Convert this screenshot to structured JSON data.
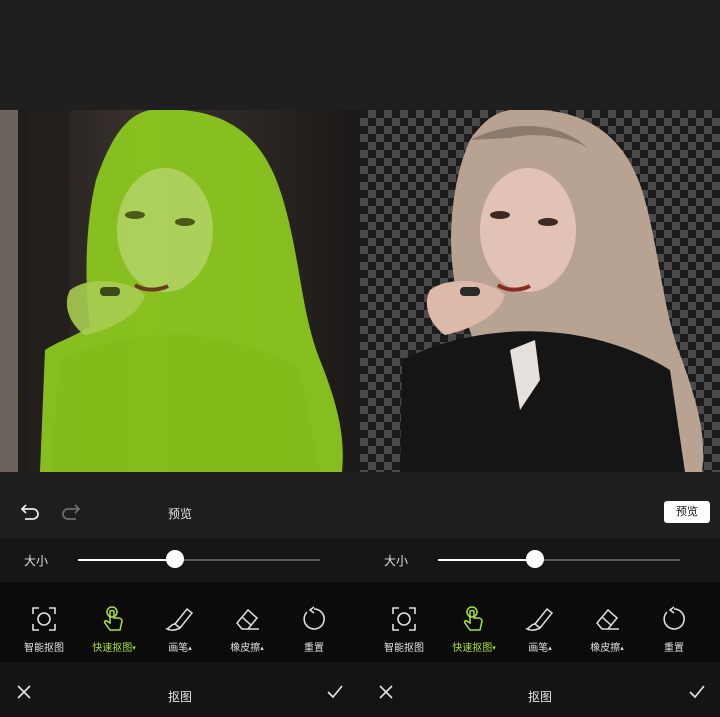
{
  "panes": [
    {
      "mode": "editing",
      "edit_bar": {
        "undo_icon": "undo-icon",
        "redo_icon": "redo-icon",
        "title": "预览",
        "preview_button": ""
      },
      "slider": {
        "label": "大小",
        "value": 0.4
      },
      "tools": [
        {
          "label": "智能抠图",
          "icon": "smart-cutout-icon",
          "active": false,
          "caret": ""
        },
        {
          "label": "快速抠图",
          "icon": "quick-cutout-icon",
          "active": true,
          "caret": "▾"
        },
        {
          "label": "画笔",
          "icon": "brush-icon",
          "active": false,
          "caret": "▴"
        },
        {
          "label": "橡皮擦",
          "icon": "eraser-icon",
          "active": false,
          "caret": "▴"
        },
        {
          "label": "重置",
          "icon": "reset-icon",
          "active": false,
          "caret": ""
        }
      ],
      "bottom_bar": {
        "title": "抠图",
        "cancel_icon": "close-icon",
        "confirm_icon": "check-icon"
      }
    },
    {
      "mode": "preview",
      "edit_bar": {
        "undo_icon": "",
        "redo_icon": "",
        "title": "",
        "preview_button": "预览"
      },
      "slider": {
        "label": "大小",
        "value": 0.4
      },
      "tools": [
        {
          "label": "智能抠图",
          "icon": "smart-cutout-icon",
          "active": false,
          "caret": ""
        },
        {
          "label": "快速抠图",
          "icon": "quick-cutout-icon",
          "active": true,
          "caret": "▾"
        },
        {
          "label": "画笔",
          "icon": "brush-icon",
          "active": false,
          "caret": "▴"
        },
        {
          "label": "橡皮擦",
          "icon": "eraser-icon",
          "active": false,
          "caret": "▴"
        },
        {
          "label": "重置",
          "icon": "reset-icon",
          "active": false,
          "caret": ""
        }
      ],
      "bottom_bar": {
        "title": "抠图",
        "cancel_icon": "close-icon",
        "confirm_icon": "check-icon"
      }
    }
  ],
  "colors": {
    "accent": "#a8e334",
    "mask": "#8fcc1f",
    "background": "#1e1e1e",
    "toolbar": "#0b0b0b"
  }
}
